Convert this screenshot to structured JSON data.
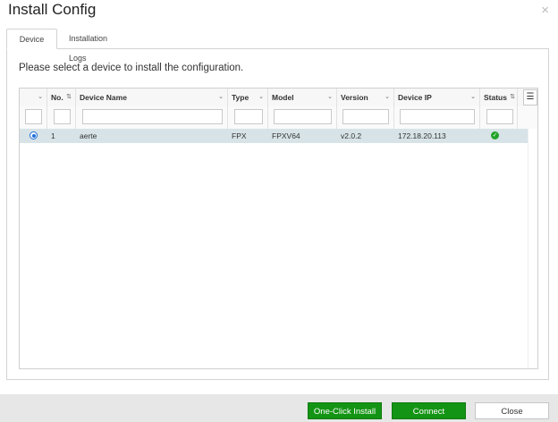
{
  "dialog": {
    "title": "Install Config",
    "close_glyph": "×"
  },
  "tabs": [
    {
      "label": "Device",
      "active": true
    },
    {
      "label": "Installation Logs",
      "active": false
    }
  ],
  "instruction": "Please select a device to install the configuration.",
  "grid": {
    "columns": [
      {
        "key": "select",
        "label": "",
        "icon": "chevron-down-icon"
      },
      {
        "key": "no",
        "label": "No.",
        "icon": "sort-icon"
      },
      {
        "key": "device_name",
        "label": "Device Name",
        "icon": "chevron-down-icon"
      },
      {
        "key": "type",
        "label": "Type",
        "icon": "chevron-down-icon"
      },
      {
        "key": "model",
        "label": "Model",
        "icon": "chevron-down-icon"
      },
      {
        "key": "version",
        "label": "Version",
        "icon": "chevron-down-icon"
      },
      {
        "key": "device_ip",
        "label": "Device IP",
        "icon": "chevron-down-icon"
      },
      {
        "key": "status",
        "label": "Status",
        "icon": "sort-icon"
      }
    ],
    "rows": [
      {
        "selected": true,
        "no": "1",
        "device_name": "aerte",
        "type": "FPX",
        "model": "FPXV64",
        "version": "v2.0.2",
        "device_ip": "172.18.20.113",
        "status_icon": "check-circle-icon"
      }
    ]
  },
  "footer": {
    "one_click_install": "One-Click Install",
    "connect": "Connect",
    "close": "Close"
  },
  "colors": {
    "accent_green": "#149414",
    "selected_row": "#d7e3e7",
    "radio_blue": "#1e6fd9",
    "status_ok": "#22a32a"
  }
}
